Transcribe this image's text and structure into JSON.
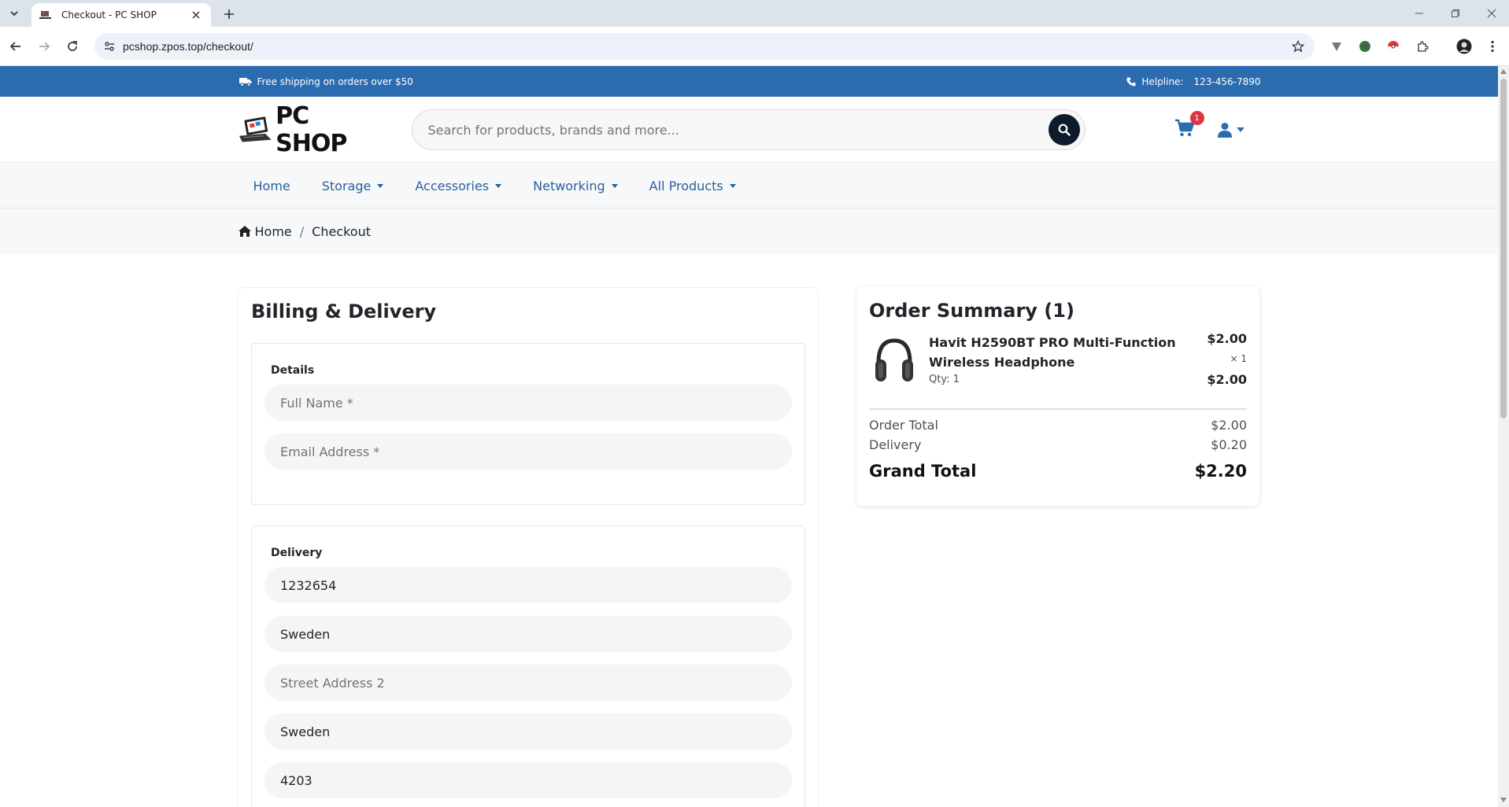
{
  "browser": {
    "tab_title": "Checkout - PC SHOP",
    "url": "pcshop.zpos.top/checkout/"
  },
  "topbar": {
    "shipping_text": "Free shipping on orders over $50",
    "helpline_label": "Helpline:",
    "helpline_number": "123-456-7890",
    "bg_color": "#2b6cb0"
  },
  "header": {
    "logo_text": "PC SHOP",
    "search_placeholder": "Search for products, brands and more...",
    "cart_count": "1"
  },
  "nav": {
    "items": [
      {
        "label": "Home",
        "dropdown": false
      },
      {
        "label": "Storage",
        "dropdown": true
      },
      {
        "label": "Accessories",
        "dropdown": true
      },
      {
        "label": "Networking",
        "dropdown": true
      },
      {
        "label": "All Products",
        "dropdown": true
      }
    ]
  },
  "breadcrumb": {
    "home": "Home",
    "current": "Checkout"
  },
  "billing": {
    "title": "Billing & Delivery",
    "details_label": "Details",
    "full_name_placeholder": "Full Name *",
    "email_placeholder": "Email Address *",
    "delivery_label": "Delivery",
    "delivery_fields": [
      {
        "value": "1232654",
        "placeholder": ""
      },
      {
        "value": "Sweden",
        "placeholder": ""
      },
      {
        "value": "",
        "placeholder": "Street Address 2"
      },
      {
        "value": "Sweden",
        "placeholder": ""
      },
      {
        "value": "4203",
        "placeholder": ""
      }
    ]
  },
  "summary": {
    "title": "Order Summary (1)",
    "item": {
      "name": "Havit H2590BT PRO Multi-Function Wireless Headphone",
      "qty": "Qty: 1",
      "price": "$2.00",
      "times": "× 1",
      "line_total": "$2.00"
    },
    "order_total_label": "Order Total",
    "order_total": "$2.00",
    "delivery_label": "Delivery",
    "delivery": "$0.20",
    "grand_total_label": "Grand Total",
    "grand_total": "$2.20"
  }
}
